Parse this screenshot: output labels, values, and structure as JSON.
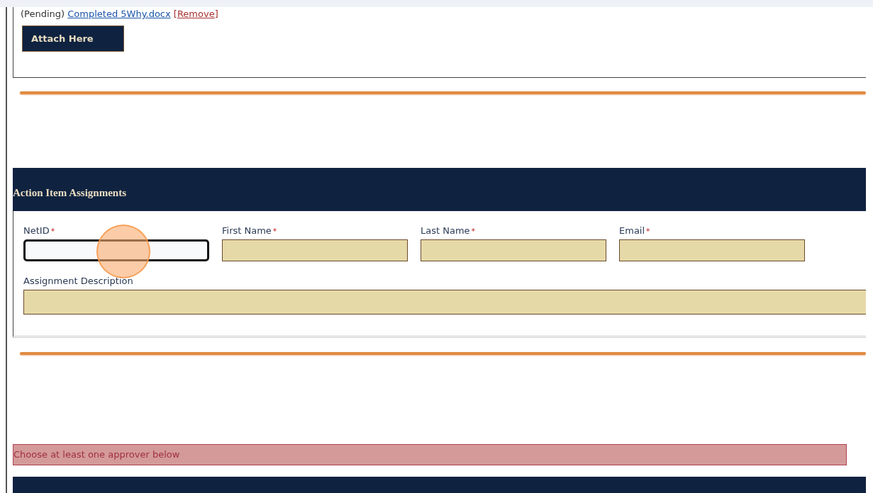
{
  "attachment": {
    "status": "(Pending)",
    "file_link": "Completed 5Why.docx",
    "remove_link": "[Remove]",
    "attach_button": "Attach Here"
  },
  "action_items": {
    "title": "Action Item Assignments",
    "fields": [
      {
        "label": "NetID",
        "required_mark": "*",
        "focused": true
      },
      {
        "label": "First Name",
        "required_mark": "*",
        "focused": false
      },
      {
        "label": "Last Name",
        "required_mark": "*",
        "focused": false
      },
      {
        "label": "Email",
        "required_mark": "*",
        "focused": false
      }
    ],
    "description": {
      "label": "Assignment Description",
      "focused": false
    }
  },
  "click_marker": true,
  "error_message": "Choose at least one approver below",
  "approvers_header": true
}
